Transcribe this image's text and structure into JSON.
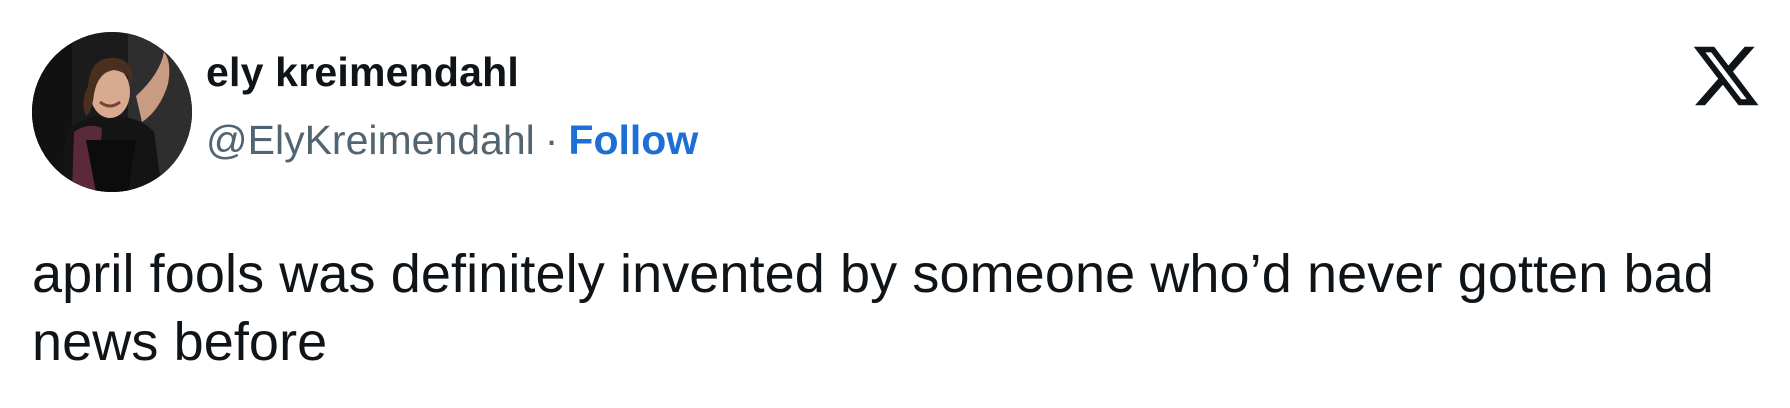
{
  "tweet": {
    "author": {
      "display_name": "ely kreimendahl",
      "handle": "@ElyKreimendahl",
      "separator": "·",
      "follow_label": "Follow",
      "avatar_icon": "profile-photo"
    },
    "platform_icon": "x-logo-icon",
    "text": "april fools was definitely invented by someone who’d never gotten bad news before"
  },
  "colors": {
    "text": "#0f1419",
    "secondary_text": "#536471",
    "link": "#1d6fd6",
    "background": "#ffffff"
  }
}
